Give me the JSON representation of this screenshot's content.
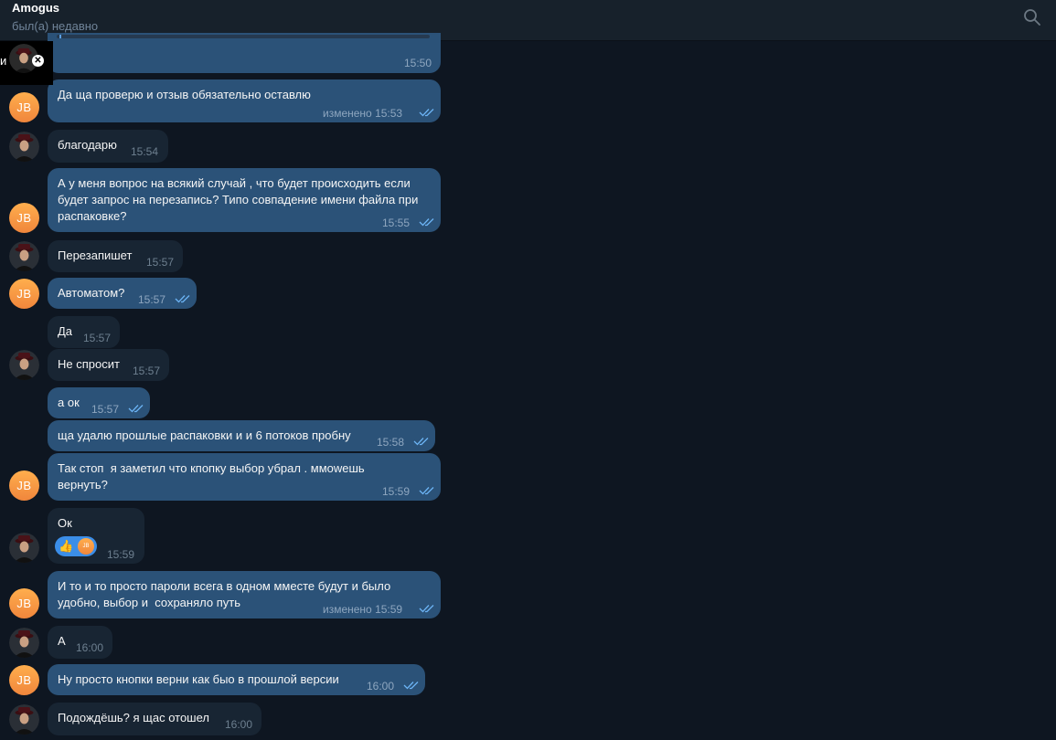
{
  "header": {
    "title": "Amogus",
    "status": "был(а) недавно"
  },
  "pip": {
    "glyph": "и"
  },
  "jb_initials": "JB",
  "messages": [
    {
      "text": "",
      "time": "15:50"
    },
    {
      "text": "Да ща проверю и отзыв обязательно оставлю",
      "time": "изменено 15:53"
    },
    {
      "text": "благодарю",
      "time": "15:54"
    },
    {
      "text": "А у меня вопрос на всякий случай , что будет происходить если\nбудет запрос на перезапись? Типо совпадение имени файла при\nраспаковке?",
      "time": "15:55"
    },
    {
      "text": "Перезапишет",
      "time": "15:57"
    },
    {
      "text": "Автоматом?",
      "time": "15:57"
    },
    {
      "text": "Да",
      "time": "15:57"
    },
    {
      "text": "Не спросит",
      "time": "15:57"
    },
    {
      "text": "а ок",
      "time": "15:57"
    },
    {
      "text": "ща удалю прошлые распаковки и и 6 потоков пробну",
      "time": "15:58"
    },
    {
      "text": "Так стоп  я заметил что кпопку выбор убрал . ммowешь\nвернуть?",
      "time": "15:59"
    },
    {
      "text": "Ок",
      "time": "15:59",
      "reaction": {
        "emoji": "👍",
        "avatar": "JB"
      }
    },
    {
      "text": "И то и то просто пароли всега в одном мместе будут и было\nудобно, выбор и  сохраняло путь",
      "time": "изменено 15:59"
    },
    {
      "text": "А",
      "time": "16:00"
    },
    {
      "text": "Ну просто кнопки верни как быо в прошлой версии",
      "time": "16:00"
    },
    {
      "text": "Подождёшь? я щас отошел",
      "time": "16:00"
    }
  ]
}
